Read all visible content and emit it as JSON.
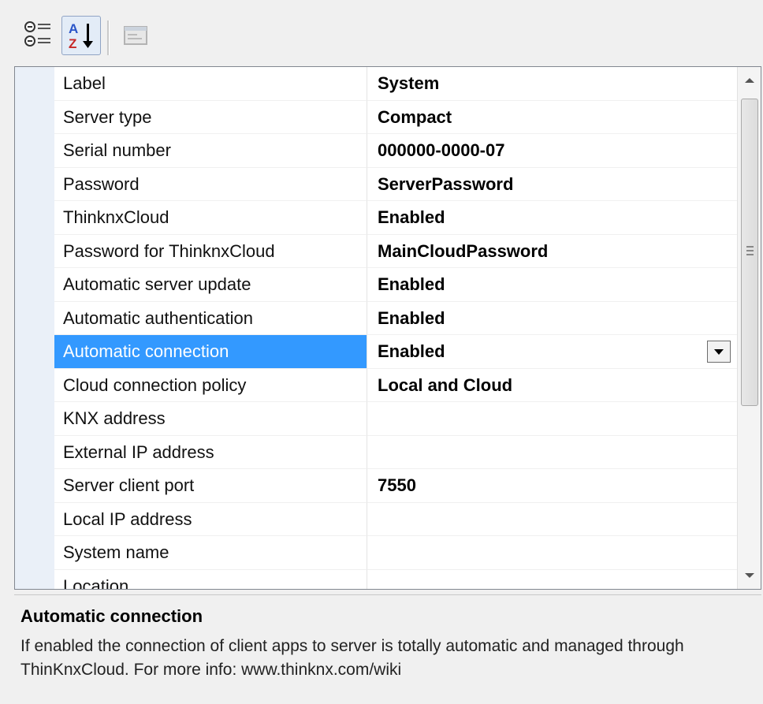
{
  "toolbar": {
    "categorized_icon": "categorized-icon",
    "alphabetical_icon": "alphabetical-sort-icon",
    "property_pages_icon": "property-pages-icon"
  },
  "properties": [
    {
      "name": "Label",
      "value": "System"
    },
    {
      "name": "Server type",
      "value": "Compact"
    },
    {
      "name": "Serial number",
      "value": "000000-0000-07"
    },
    {
      "name": "Password",
      "value": "ServerPassword"
    },
    {
      "name": "ThinknxCloud",
      "value": "Enabled"
    },
    {
      "name": "Password for ThinknxCloud",
      "value": "MainCloudPassword"
    },
    {
      "name": "Automatic server update",
      "value": "Enabled"
    },
    {
      "name": "Automatic authentication",
      "value": "Enabled"
    },
    {
      "name": "Automatic connection",
      "value": "Enabled"
    },
    {
      "name": "Cloud connection policy",
      "value": "Local and Cloud"
    },
    {
      "name": "KNX address",
      "value": ""
    },
    {
      "name": "External IP address",
      "value": ""
    },
    {
      "name": "Server client port",
      "value": "7550"
    },
    {
      "name": "Local IP address",
      "value": ""
    },
    {
      "name": "System name",
      "value": ""
    },
    {
      "name": "Location",
      "value": ""
    }
  ],
  "description": {
    "title": "Automatic connection",
    "text": "If enabled the connection of client apps to server is totally automatic and managed through ThinKnxCloud. For more info: www.thinknx.com/wiki"
  }
}
